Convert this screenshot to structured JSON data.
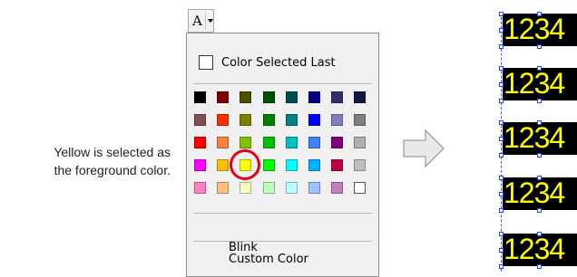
{
  "caption": {
    "line1": "Yellow is selected as",
    "line2": "the foreground color."
  },
  "toolbar": {
    "font_color_glyph": "A"
  },
  "palette": {
    "color_selected_last": "Color Selected Last",
    "blink": "Blink",
    "custom_color": "Custom Color",
    "selected_color": "#ffff00",
    "rows": [
      [
        "#000000",
        "#800000",
        "#4f4f00",
        "#005000",
        "#004d4d",
        "#000080",
        "#30306a",
        "#101840"
      ],
      [
        "#805050",
        "#ff3000",
        "#808000",
        "#008000",
        "#008080",
        "#0000ff",
        "#8080c0",
        "#808080"
      ],
      [
        "#ff0000",
        "#ff8040",
        "#80c000",
        "#00c000",
        "#00c0c0",
        "#4080ff",
        "#800080",
        "#b0b0b0"
      ],
      [
        "#ff00ff",
        "#ffc000",
        "#ffff00",
        "#00ff00",
        "#00ffff",
        "#00b0ff",
        "#c00040",
        "#c0c0c0"
      ],
      [
        "#ff80c0",
        "#ffc080",
        "#ffffc0",
        "#c0ffc0",
        "#c0ffff",
        "#a0c0ff",
        "#c080c0",
        "#ffffff"
      ]
    ]
  },
  "preview": {
    "text": "1234",
    "text_color": "#ffff00",
    "background_color": "#000000"
  }
}
